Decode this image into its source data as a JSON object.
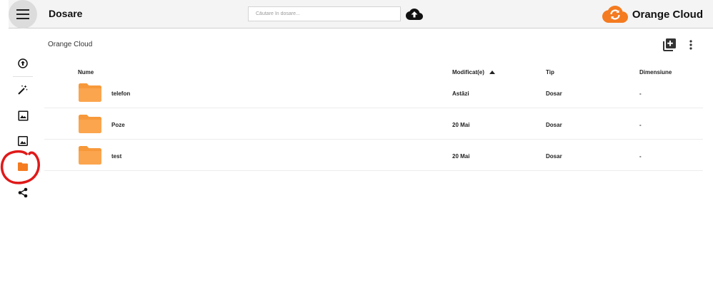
{
  "header": {
    "title": "Dosare",
    "search_placeholder": "Căutare în dosare...",
    "brand_name": "Orange Cloud",
    "brand_color": "#f47b20"
  },
  "sidebar": {
    "items": [
      {
        "icon": "arrow-up-circle-icon"
      },
      {
        "icon": "magic-wand-icon"
      },
      {
        "icon": "photo-library-icon"
      },
      {
        "icon": "image-icon"
      },
      {
        "icon": "folder-icon",
        "active": true,
        "color": "#f47b20"
      },
      {
        "icon": "share-icon"
      }
    ],
    "annotation_color": "#e01919"
  },
  "main": {
    "breadcrumb": "Orange Cloud",
    "table": {
      "columns": [
        "Nume",
        "Modificat(e)",
        "Tip",
        "Dimensiune"
      ],
      "sort_column": "Modificat(e)",
      "sort_direction": "ascending",
      "rows": [
        {
          "name": "telefon",
          "modified": "Astăzi",
          "type": "Dosar",
          "size": "-"
        },
        {
          "name": "Poze",
          "modified": "20 Mai",
          "type": "Dosar",
          "size": "-"
        },
        {
          "name": "test",
          "modified": "20 Mai",
          "type": "Dosar",
          "size": "-"
        }
      ]
    },
    "folder_color": "#f7993a"
  }
}
